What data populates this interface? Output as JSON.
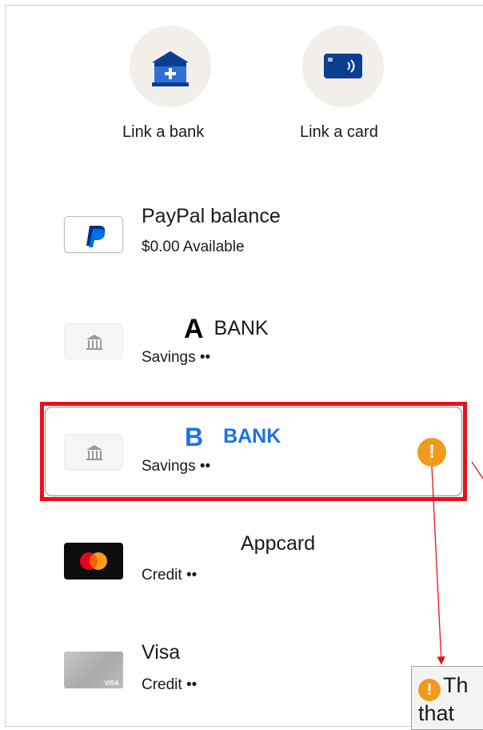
{
  "quick_actions": {
    "link_bank": {
      "label": "Link a bank",
      "icon": "bank-add-icon"
    },
    "link_card": {
      "label": "Link a card",
      "icon": "card-contactless-icon"
    }
  },
  "payment_methods": [
    {
      "name": "PayPal balance",
      "detail": "$0.00 Available",
      "icon": "paypal-logo-icon"
    },
    {
      "letter": "A",
      "name": "BANK",
      "detail": "Savings ••",
      "icon": "bank-icon"
    },
    {
      "letter": "B",
      "name": "BANK",
      "detail": "Savings ••",
      "icon": "bank-icon",
      "selected": true,
      "warning": "!"
    },
    {
      "name": "Appcard",
      "detail": "Credit ••",
      "icon": "mastercard-icon"
    },
    {
      "name": "Visa",
      "detail": "Credit ••",
      "icon": "visa-card-icon",
      "card_mark": "VISA"
    }
  ],
  "tooltip": {
    "icon": "!",
    "text": "Th",
    "text_line2": "that"
  },
  "colors": {
    "brand_blue": "#0a4fbf",
    "bank_b_blue": "#1a73e8",
    "warning_orange": "#f29a1c",
    "highlight_red": "#e8111a",
    "circle_bg": "#f2efea"
  }
}
